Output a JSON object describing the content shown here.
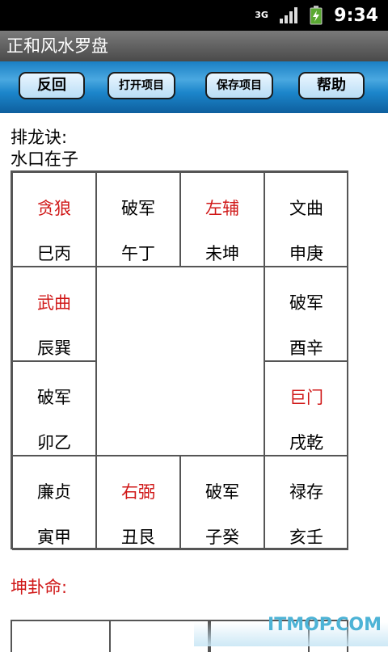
{
  "status_bar": {
    "network_label": "3G",
    "time": "9:34"
  },
  "app": {
    "title": "正和风水罗盘"
  },
  "toolbar": {
    "back_label": "反回",
    "open_label": "打开项目",
    "save_label": "保存项目",
    "help_label": "帮助"
  },
  "main": {
    "header_line1": "排龙诀:",
    "header_line2": "水口在子",
    "footer_label": "坤卦命:",
    "grid": {
      "row1": [
        {
          "star": "贪狼",
          "dir": "巳丙",
          "highlight": true
        },
        {
          "star": "破军",
          "dir": "午丁",
          "highlight": false
        },
        {
          "star": "左辅",
          "dir": "未坤",
          "highlight": true
        },
        {
          "star": "文曲",
          "dir": "申庚",
          "highlight": false
        }
      ],
      "left": [
        {
          "star": "武曲",
          "dir": "辰巽",
          "highlight": true
        },
        {
          "star": "破军",
          "dir": "卯乙",
          "highlight": false
        }
      ],
      "right": [
        {
          "star": "破军",
          "dir": "酉辛",
          "highlight": false
        },
        {
          "star": "巨门",
          "dir": "戌乾",
          "highlight": true
        }
      ],
      "row4": [
        {
          "star": "廉贞",
          "dir": "寅甲",
          "highlight": false
        },
        {
          "star": "右弼",
          "dir": "丑艮",
          "highlight": true
        },
        {
          "star": "破军",
          "dir": "子癸",
          "highlight": false
        },
        {
          "star": "禄存",
          "dir": "亥壬",
          "highlight": false
        }
      ]
    }
  },
  "watermark": "ITMOP.COM",
  "colors": {
    "highlight": "#d01818",
    "toolbar": "#1a7fc4"
  }
}
